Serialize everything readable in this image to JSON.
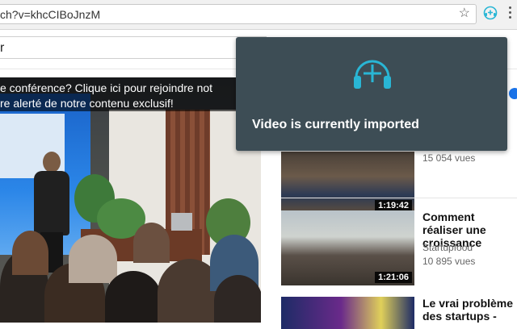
{
  "browser": {
    "url": "ch?v=khcCIBoJnzM",
    "star_icon": "star-icon",
    "extension_icon": "headphones-plus-icon",
    "menu_icon": "kebab-menu-icon"
  },
  "youtube": {
    "search_value": "r"
  },
  "player": {
    "overlay_line1": "e conférence? Clique ici pour rejoindre not",
    "overlay_line2": "re alerté de notre contenu exclusif!"
  },
  "related": [
    {
      "views": "15 054 vues",
      "duration": "1:19:42"
    },
    {
      "title": "Comment réaliser une croissance",
      "channel": "Startupfood",
      "views": "10 895 vues",
      "duration": "1:21:06"
    },
    {
      "title": "Le vrai problème des startups -"
    }
  ],
  "popup": {
    "message": "Video is currently imported",
    "icon": "headphones-plus-icon",
    "accent_color": "#29b6d5",
    "background_color": "#3d4d55"
  }
}
